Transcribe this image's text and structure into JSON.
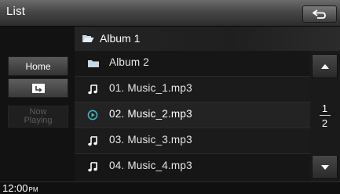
{
  "header": {
    "title": "List"
  },
  "breadcrumb": {
    "label": "Album 1"
  },
  "sidebar": {
    "home_label": "Home",
    "now_playing_line1": "Now",
    "now_playing_line2": "Playing"
  },
  "list": {
    "items": [
      {
        "label": "Album 2",
        "icon": "folder-icon"
      },
      {
        "label": "01. Music_1.mp3",
        "icon": "music-note-icon"
      },
      {
        "label": "02. Music_2.mp3",
        "icon": "play-circle-icon",
        "selected": true
      },
      {
        "label": "03. Music_3.mp3",
        "icon": "music-note-icon"
      },
      {
        "label": "04. Music_4.mp3",
        "icon": "music-note-icon"
      }
    ]
  },
  "pager": {
    "current": "1",
    "total": "2"
  },
  "status": {
    "time": "12:00",
    "ampm": "PM"
  },
  "colors": {
    "accent": "#3fb6c7",
    "background": "#141414",
    "text": "#ffffff"
  }
}
